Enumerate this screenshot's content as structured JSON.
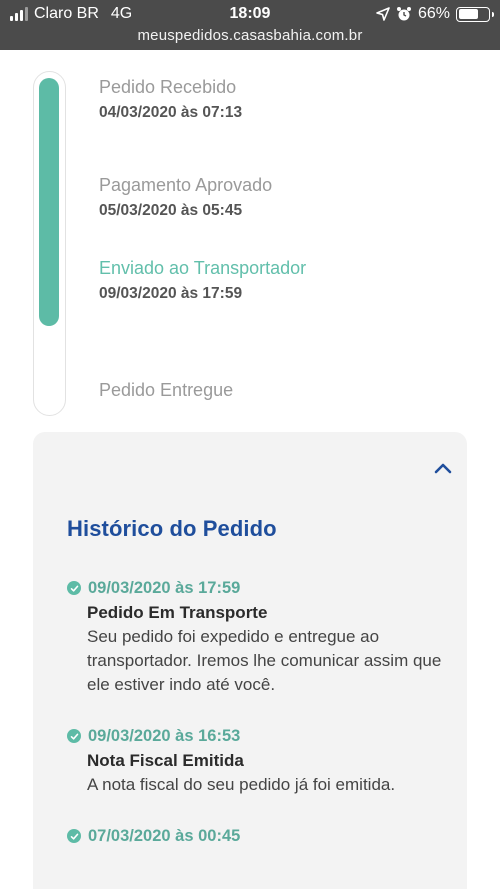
{
  "status_bar": {
    "carrier": "Claro BR",
    "network": "4G",
    "time": "18:09",
    "battery": "66%",
    "battery_level": 0.66,
    "url": "meuspedidos.casasbahia.com.br"
  },
  "timeline": {
    "progress_fraction": 0.75,
    "steps": [
      {
        "title": "Pedido Recebido",
        "date": "04/03/2020 às 07:13",
        "active": false
      },
      {
        "title": "Pagamento Aprovado",
        "date": "05/03/2020 às 05:45",
        "active": false
      },
      {
        "title": "Enviado ao Transportador",
        "date": "09/03/2020 às 17:59",
        "active": true
      },
      {
        "title": "Pedido Entregue",
        "date": "",
        "active": false
      }
    ]
  },
  "history": {
    "title": "Histórico do Pedido",
    "entries": [
      {
        "date": "09/03/2020 às 17:59",
        "title": "Pedido Em Transporte",
        "description": "Seu pedido foi expedido e entregue ao transportador. Iremos lhe comunicar assim que ele estiver indo até você."
      },
      {
        "date": "09/03/2020 às 16:53",
        "title": "Nota Fiscal Emitida",
        "description": "A nota fiscal do seu pedido já foi emitida."
      },
      {
        "date": "07/03/2020 às 00:45",
        "title": "",
        "description": ""
      }
    ]
  },
  "colors": {
    "accent": "#5dbba6",
    "title_blue": "#1f4e9c",
    "status_bar_bg": "#4b4b4b"
  }
}
